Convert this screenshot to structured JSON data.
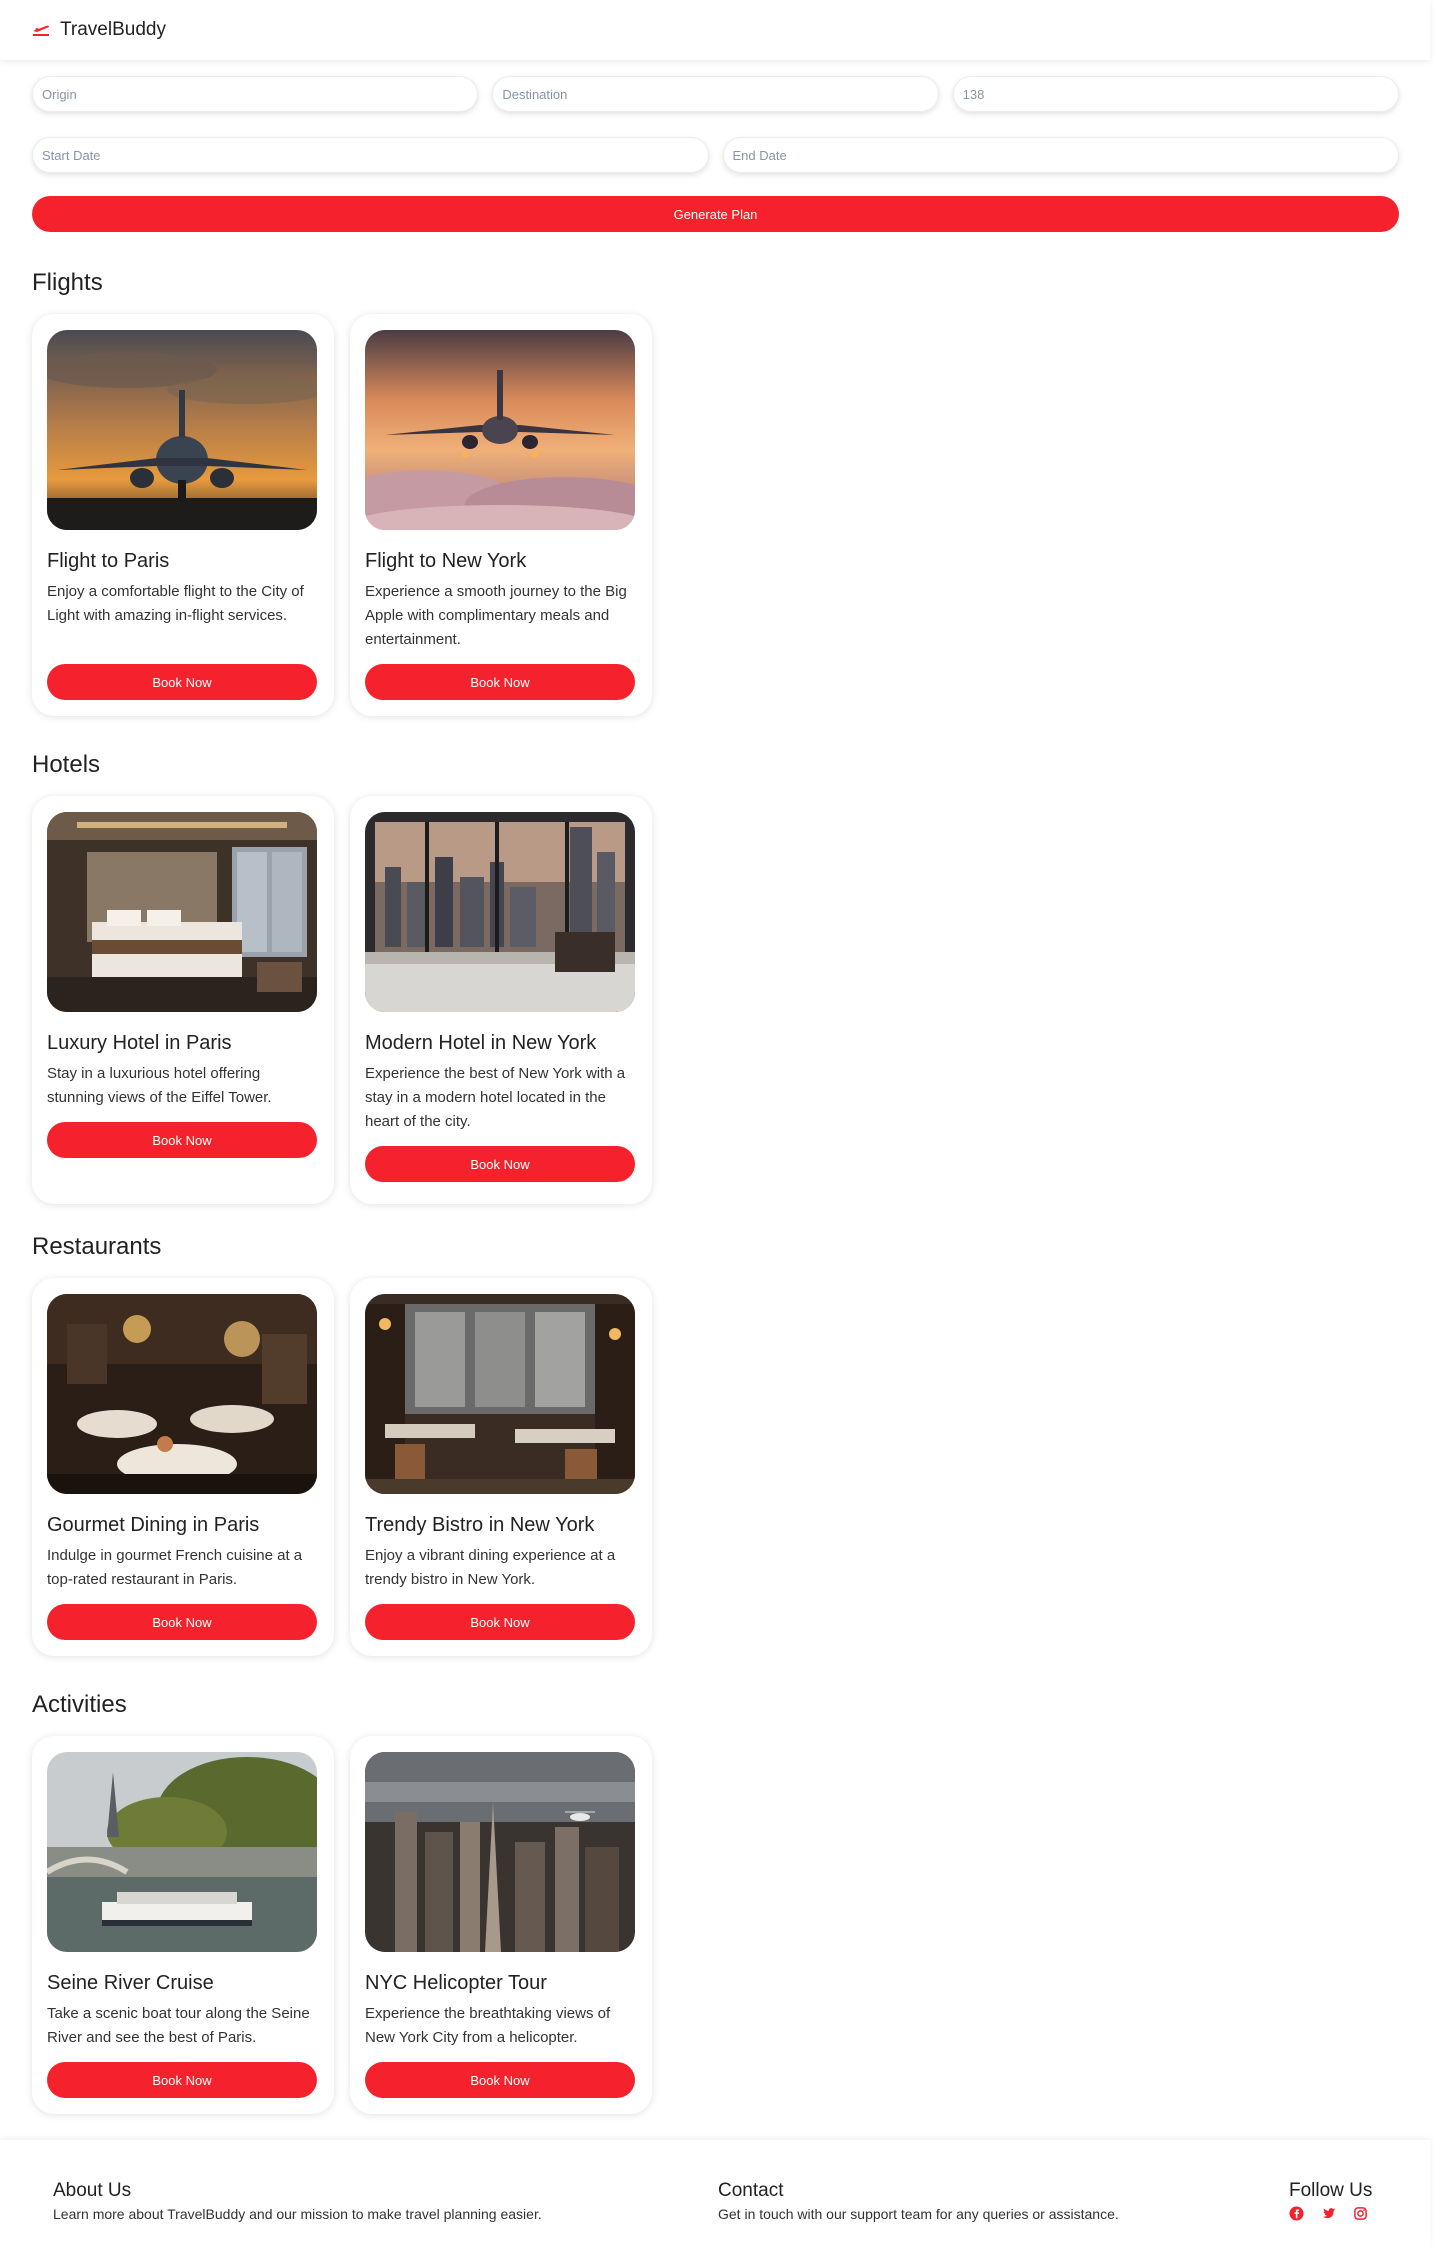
{
  "header": {
    "brand": "TravelBuddy",
    "logo_icon": "plane-departure-icon",
    "accent": "#f5222d"
  },
  "form": {
    "origin": {
      "placeholder": "Origin",
      "value": ""
    },
    "destination": {
      "placeholder": "Destination",
      "value": ""
    },
    "budget": {
      "placeholder": "",
      "value": "138"
    },
    "start_date": {
      "placeholder": "Start Date",
      "value": ""
    },
    "end_date": {
      "placeholder": "End Date",
      "value": ""
    },
    "generate_label": "Generate Plan"
  },
  "sections": [
    {
      "title": "Flights",
      "cards": [
        {
          "title": "Flight to Paris",
          "desc": "Enjoy a comfortable flight to the City of Light with amazing in-flight services.",
          "button": "Book Now",
          "image": "airplane-sunset-photo"
        },
        {
          "title": "Flight to New York",
          "desc": "Experience a smooth journey to the Big Apple with complimentary meals and entertainment.",
          "button": "Book Now",
          "image": "airplane-clouds-photo"
        }
      ]
    },
    {
      "title": "Hotels",
      "cards": [
        {
          "title": "Luxury Hotel in Paris",
          "desc": "Stay in a luxurious hotel offering stunning views of the Eiffel Tower.",
          "button": "Book Now",
          "image": "hotel-room-photo"
        },
        {
          "title": "Modern Hotel in New York",
          "desc": "Experience the best of New York with a stay in a modern hotel located in the heart of the city.",
          "button": "Book Now",
          "image": "hotel-city-view-photo"
        }
      ]
    },
    {
      "title": "Restaurants",
      "cards": [
        {
          "title": "Gourmet Dining in Paris",
          "desc": "Indulge in gourmet French cuisine at a top-rated restaurant in Paris.",
          "button": "Book Now",
          "image": "restaurant-interior-photo"
        },
        {
          "title": "Trendy Bistro in New York",
          "desc": "Enjoy a vibrant dining experience at a trendy bistro in New York.",
          "button": "Book Now",
          "image": "bistro-interior-photo"
        }
      ]
    },
    {
      "title": "Activities",
      "cards": [
        {
          "title": "Seine River Cruise",
          "desc": "Take a scenic boat tour along the Seine River and see the best of Paris.",
          "button": "Book Now",
          "image": "river-cruise-photo"
        },
        {
          "title": "NYC Helicopter Tour",
          "desc": "Experience the breathtaking views of New York City from a helicopter.",
          "button": "Book Now",
          "image": "nyc-aerial-photo"
        }
      ]
    }
  ],
  "footer": {
    "about_title": "About Us",
    "about_text": "Learn more about TravelBuddy and our mission to make travel planning easier.",
    "contact_title": "Contact",
    "contact_text": "Get in touch with our support team for any queries or assistance.",
    "follow_title": "Follow Us",
    "socials": [
      "facebook-icon",
      "twitter-icon",
      "instagram-icon"
    ]
  }
}
